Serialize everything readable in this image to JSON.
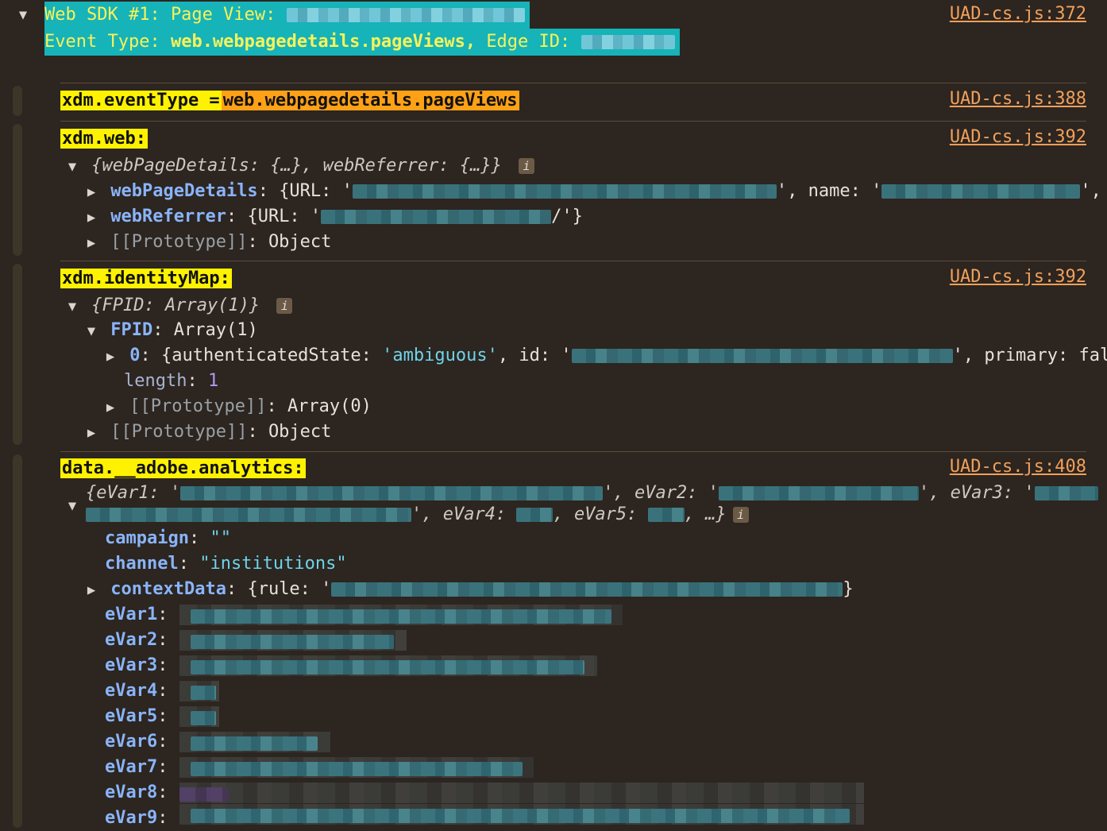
{
  "header": {
    "title": "Web SDK #1: Page View:",
    "event_type_label": "Event Type:",
    "event_type_value": "web.webpagedetails.pageViews,",
    "edge_id_label": "Edge ID:",
    "source": "UAD-cs.js:372"
  },
  "event_type_line": {
    "label": "xdm.eventType =",
    "value": "web.webpagedetails.pageViews",
    "source": "UAD-cs.js:388"
  },
  "web_section": {
    "label": "xdm.web:",
    "source": "UAD-cs.js:392",
    "preview": "{webPageDetails: {…}, webReferrer: {…}}",
    "rows": [
      {
        "key": "webPageDetails",
        "text": "{URL: '",
        "tail": "', name: '",
        "end": "',"
      },
      {
        "key": "webReferrer",
        "text": "{URL: '",
        "tail": "/'}"
      },
      {
        "key": "[[Prototype]]",
        "text": "Object"
      }
    ]
  },
  "identity_section": {
    "label": "xdm.identityMap:",
    "source": "UAD-cs.js:392",
    "preview": "{FPID: Array(1)}",
    "fpid_key": "FPID",
    "fpid_value": "Array(1)",
    "item_key": "0",
    "item_open": "{authenticatedState: ",
    "item_state": "'ambiguous'",
    "item_id": ", id: '",
    "item_tail": "', primary: fal",
    "length_key": "length",
    "length_value": "1",
    "proto_array_key": "[[Prototype]]",
    "proto_array_value": "Array(0)",
    "proto_object_key": "[[Prototype]]",
    "proto_object_value": "Object"
  },
  "analytics_section": {
    "label": "data.__adobe.analytics:",
    "source": "UAD-cs.js:408",
    "preview_1a": "{eVar1: '",
    "preview_1b": "', eVar2: '",
    "preview_1c": "', eVar3: '",
    "preview_2a": "', eVar4: ",
    "preview_2b": ", eVar5: ",
    "preview_2c": ", …}",
    "campaign_key": "campaign",
    "campaign_value": "\"\"",
    "channel_key": "channel",
    "channel_value": "\"institutions\"",
    "context_key": "contextData",
    "context_open": "{rule: '",
    "context_close": "}",
    "evars": [
      "eVar1",
      "eVar2",
      "eVar3",
      "eVar4",
      "eVar5",
      "eVar6",
      "eVar7",
      "eVar8",
      "eVar9"
    ]
  },
  "icons": {
    "expand": "triangle-down",
    "collapse": "triangle-right",
    "info": "info-badge"
  },
  "colors": {
    "background": "#2c2520",
    "header_bg": "#16b3b8",
    "highlight_yellow": "#fff200",
    "highlight_orange": "#ffa116",
    "link": "#f2a05a"
  }
}
